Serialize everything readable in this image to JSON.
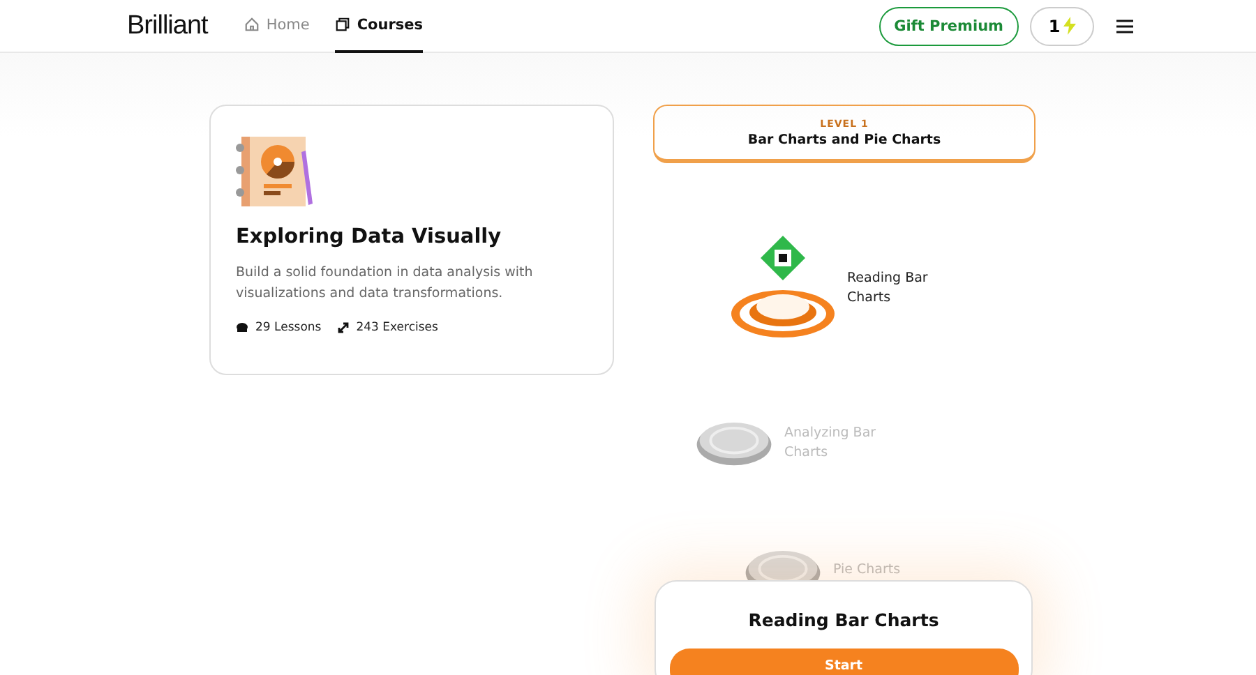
{
  "header": {
    "logo": "Brilliant",
    "nav": [
      {
        "label": "Home",
        "selected": false
      },
      {
        "label": "Courses",
        "selected": true
      }
    ],
    "gift_button": "Gift Premium",
    "streak": "1"
  },
  "course": {
    "title": "Exploring Data Visually",
    "description": "Build a solid foundation in data analysis with visualizations and data transformations.",
    "lessons": "29 Lessons",
    "exercises": "243 Exercises"
  },
  "level": {
    "label": "LEVEL 1",
    "title": "Bar Charts and Pie Charts"
  },
  "lessons": [
    {
      "title": "Reading Bar Charts",
      "kind": "current"
    },
    {
      "title": "Analyzing Bar Charts",
      "kind": "locked"
    },
    {
      "title": "Pie Charts",
      "kind": "locked"
    }
  ],
  "popup": {
    "title": "Reading Bar Charts",
    "button": "Start"
  }
}
